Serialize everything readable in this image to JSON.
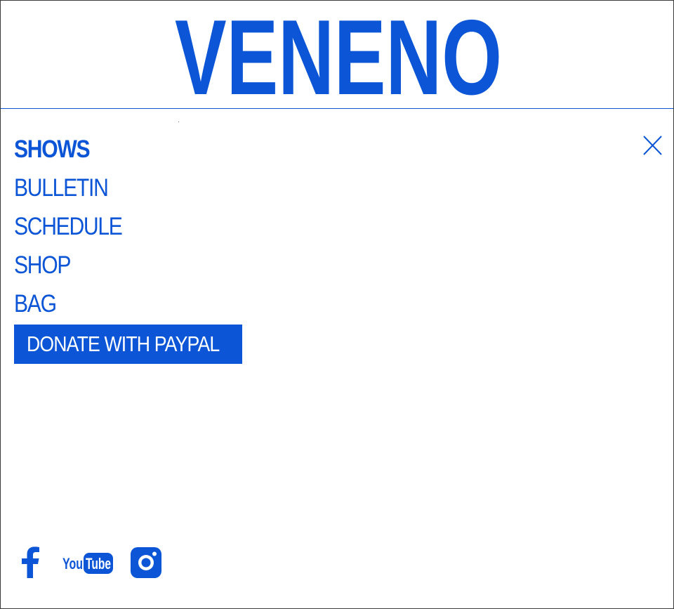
{
  "brand": {
    "logo_text": "VENENO",
    "color": "#0b55d6"
  },
  "nav": {
    "items": [
      {
        "label": "SHOWS",
        "active": true
      },
      {
        "label": "BULLETIN",
        "active": false
      },
      {
        "label": "SCHEDULE",
        "active": false
      },
      {
        "label": "SHOP",
        "active": false
      },
      {
        "label": "BAG",
        "active": false
      }
    ],
    "donate_label": "DONATE WITH PAYPAL"
  },
  "icons": {
    "close": "close-icon",
    "facebook": "facebook-icon",
    "youtube": "youtube-icon",
    "instagram": "instagram-icon"
  },
  "social": {
    "youtube_label": "YouTube"
  }
}
